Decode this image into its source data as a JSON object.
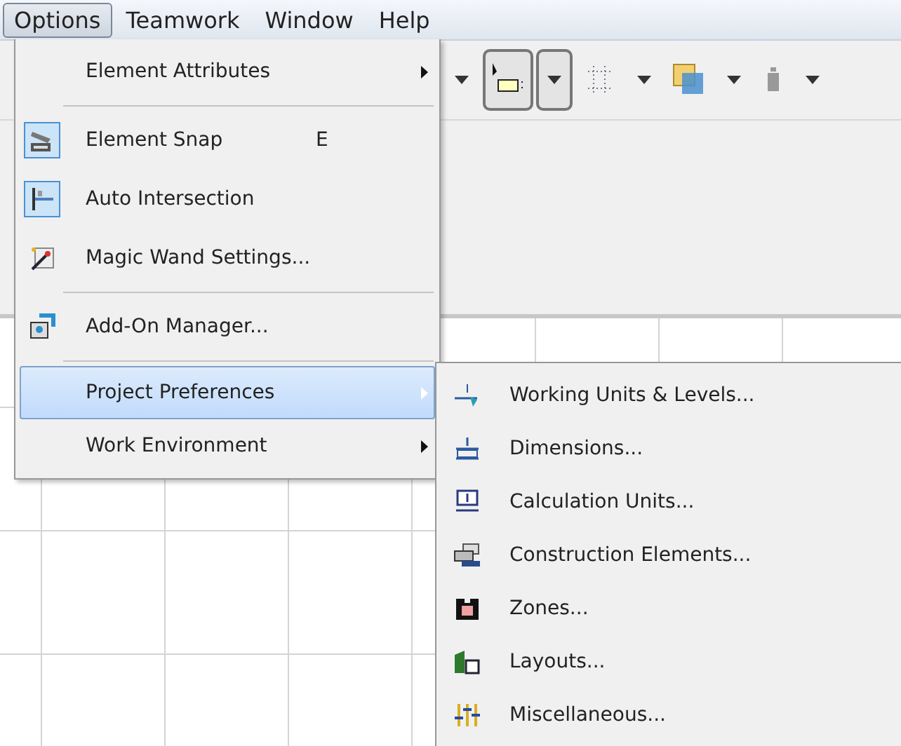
{
  "menubar": [
    {
      "label": "Options",
      "selected": true
    },
    {
      "label": "Teamwork",
      "selected": false
    },
    {
      "label": "Window",
      "selected": false
    },
    {
      "label": "Help",
      "selected": false
    }
  ],
  "options_menu": [
    {
      "kind": "command",
      "label": "Element Attributes",
      "submenu": true,
      "checked": false,
      "selected": false
    },
    {
      "kind": "separator"
    },
    {
      "kind": "command",
      "label": "Element Snap",
      "shortcut": "E",
      "checked": true,
      "selected": false
    },
    {
      "kind": "command",
      "label": "Auto Intersection",
      "checked": true,
      "selected": false
    },
    {
      "kind": "command",
      "label": "Magic Wand Settings...",
      "checked": false,
      "selected": false
    },
    {
      "kind": "separator"
    },
    {
      "kind": "command",
      "label": "Add-On Manager...",
      "checked": false,
      "selected": false
    },
    {
      "kind": "separator"
    },
    {
      "kind": "command",
      "label": "Project Preferences",
      "submenu": true,
      "checked": false,
      "selected": true
    },
    {
      "kind": "command",
      "label": "Work Environment",
      "submenu": true,
      "checked": false,
      "selected": false
    }
  ],
  "submenu": [
    {
      "label": "Working Units & Levels..."
    },
    {
      "label": "Dimensions..."
    },
    {
      "label": "Calculation Units..."
    },
    {
      "label": "Construction Elements..."
    },
    {
      "label": "Zones..."
    },
    {
      "label": "Layouts..."
    },
    {
      "label": "Miscellaneous..."
    }
  ]
}
